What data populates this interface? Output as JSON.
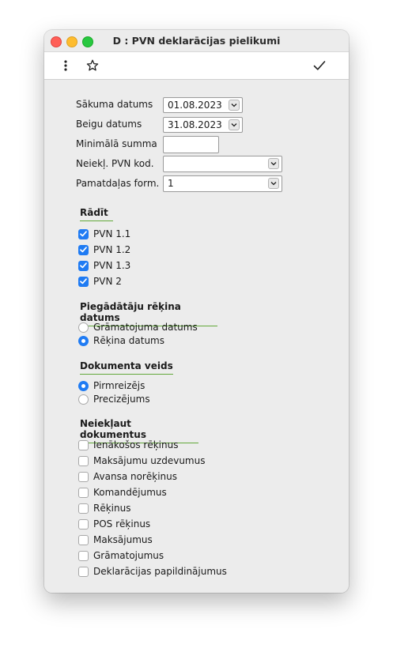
{
  "window": {
    "title": "D : PVN deklarācijas pielikumi"
  },
  "toolbar": {
    "menu_icon": "more-vertical-icon",
    "favorite_icon": "star-icon",
    "confirm_icon": "checkmark-icon"
  },
  "form": {
    "start_date": {
      "label": "Sākuma datums",
      "value": "01.08.2023"
    },
    "end_date": {
      "label": "Beigu datums",
      "value": "31.08.2023"
    },
    "min_sum": {
      "label": "Minimālā summa",
      "value": ""
    },
    "vat_code": {
      "label": "Neiekļ. PVN kod.",
      "value": ""
    },
    "base_form": {
      "label": "Pamatdaļas form.",
      "value": "1"
    }
  },
  "show": {
    "heading": "Rādīt",
    "items": [
      {
        "label": "PVN 1.1",
        "checked": true
      },
      {
        "label": "PVN 1.2",
        "checked": true
      },
      {
        "label": "PVN 1.3",
        "checked": true
      },
      {
        "label": "PVN 2",
        "checked": true
      }
    ]
  },
  "supplier_date": {
    "heading": "Piegādātāju rēķina datums",
    "options": [
      {
        "label": "Grāmatojuma datums",
        "selected": false
      },
      {
        "label": "Rēķina datums",
        "selected": true
      }
    ]
  },
  "doc_type": {
    "heading": "Dokumenta veids",
    "options": [
      {
        "label": "Pirmreizējs",
        "selected": true
      },
      {
        "label": "Precizējums",
        "selected": false
      }
    ]
  },
  "exclude": {
    "heading": "Neiekļaut dokumentus",
    "items": [
      {
        "label": "Ienākošos rēķinus",
        "checked": false
      },
      {
        "label": "Maksājumu uzdevumus",
        "checked": false
      },
      {
        "label": "Avansa norēķinus",
        "checked": false
      },
      {
        "label": "Komandējumus",
        "checked": false
      },
      {
        "label": "Rēķinus",
        "checked": false
      },
      {
        "label": "POS rēķinus",
        "checked": false
      },
      {
        "label": "Maksājumus",
        "checked": false
      },
      {
        "label": "Grāmatojumus",
        "checked": false
      },
      {
        "label": "Deklarācijas papildinājumus",
        "checked": false
      }
    ]
  },
  "colors": {
    "accent": "#1f7bf3",
    "section_underline": "#62a83a"
  }
}
